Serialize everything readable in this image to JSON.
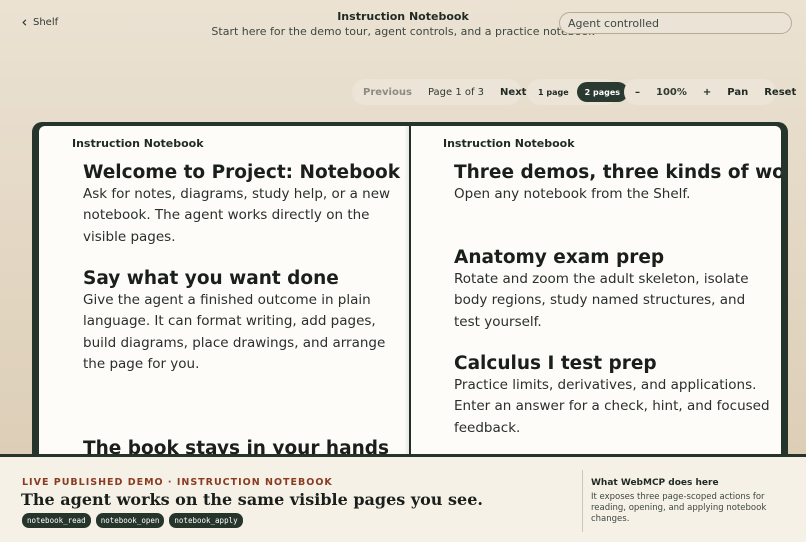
{
  "header": {
    "back_label": "Shelf",
    "title": "Instruction Notebook",
    "subtitle": "Start here for the demo tour, agent controls, and a practice notebook",
    "mode": "Agent controlled"
  },
  "pager": {
    "previous": "Previous",
    "page_indicator": "Page 1 of 3",
    "next": "Next"
  },
  "view": {
    "one_page": "1 page",
    "two_pages": "2 pages",
    "active": "2 pages"
  },
  "zoom": {
    "minus": "–",
    "level": "100%",
    "plus": "+",
    "pan": "Pan",
    "reset": "Reset"
  },
  "left_page": {
    "header": "Instruction Notebook",
    "sections": [
      {
        "title": "Welcome to Project: Notebook",
        "body": "Ask for notes, diagrams, study help, or a new notebook. The agent works directly on the visible pages."
      },
      {
        "title": "Say what you want done",
        "body": "Give the agent a finished outcome in plain language. It can format writing, add pages, build diagrams, place drawings, and arrange the page for you."
      },
      {
        "title": "The book stays in your hands",
        "body": ""
      }
    ]
  },
  "right_page": {
    "header": "Instruction Notebook",
    "sections": [
      {
        "title": "Three demos, three kinds of work",
        "body": "Open any notebook from the Shelf."
      },
      {
        "title": "Anatomy exam prep",
        "body": "Rotate and zoom the adult skeleton, isolate body regions, study named structures, and test yourself."
      },
      {
        "title": "Calculus I test prep",
        "body": "Practice limits, derivatives, and applications. Enter an answer for a check, hint, and focused feedback."
      }
    ]
  },
  "footer": {
    "kicker": "LIVE PUBLISHED DEMO · INSTRUCTION NOTEBOOK",
    "tagline": "The agent works on the same visible pages you see.",
    "tools": [
      "notebook_read",
      "notebook_open",
      "notebook_apply"
    ],
    "side_title": "What WebMCP does here",
    "side_body": "It exposes three page-scoped actions for reading, opening, and applying notebook changes."
  },
  "colors": {
    "accent_dark": "#26352c",
    "kicker": "#8a3b22",
    "page_bg": "#fdfcf8"
  }
}
